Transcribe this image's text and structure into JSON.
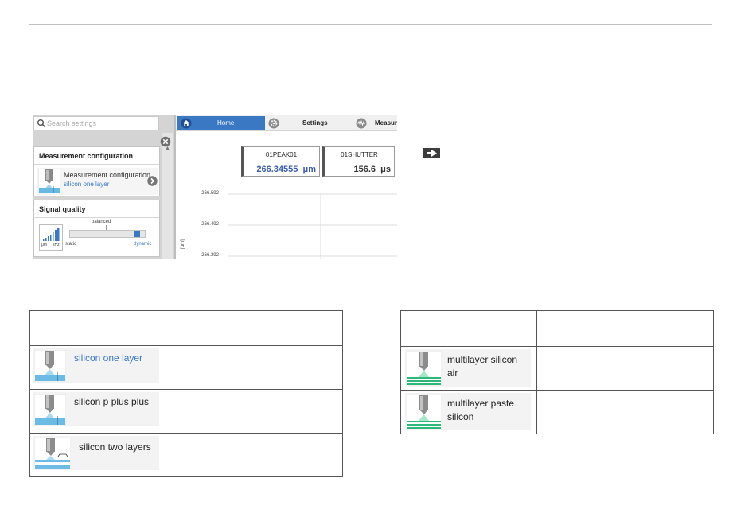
{
  "search": {
    "placeholder": "Search settings"
  },
  "measurement_configuration": {
    "heading": "Measurement configuration",
    "item_title": "Measurement configuration",
    "item_value": "silicon one layer"
  },
  "signal_quality": {
    "heading": "Signal quality",
    "label_balanced": "balanced",
    "label_static": "static",
    "label_dynamic": "dynamic",
    "icon_units_left": "μm",
    "icon_units_right": "kHz",
    "selected_fraction": 0.93
  },
  "tabs": {
    "home": "Home",
    "settings": "Settings",
    "measure": "Measure"
  },
  "readouts": [
    {
      "name": "01PEAK01",
      "value": "266.34555",
      "unit": "μm"
    },
    {
      "name": "01SHUTTER",
      "value": "156.6",
      "unit": "μs"
    }
  ],
  "plot": {
    "yticks": [
      "266.592",
      "266.492",
      "266.392"
    ],
    "ylabel": "[µm]"
  },
  "table_left": {
    "rows": [
      {
        "label": "silicon one layer",
        "highlight": true
      },
      {
        "label": "silicon p plus plus",
        "highlight": false
      },
      {
        "label": "silicon two layers",
        "highlight": false
      }
    ]
  },
  "table_right": {
    "rows": [
      {
        "label": "multilayer silicon air"
      },
      {
        "label": "multilayer paste silicon"
      }
    ]
  },
  "colors": {
    "accent": "#3b78c4",
    "value_blue": "#3b5cab",
    "multilayer_green": "#2db87a"
  }
}
